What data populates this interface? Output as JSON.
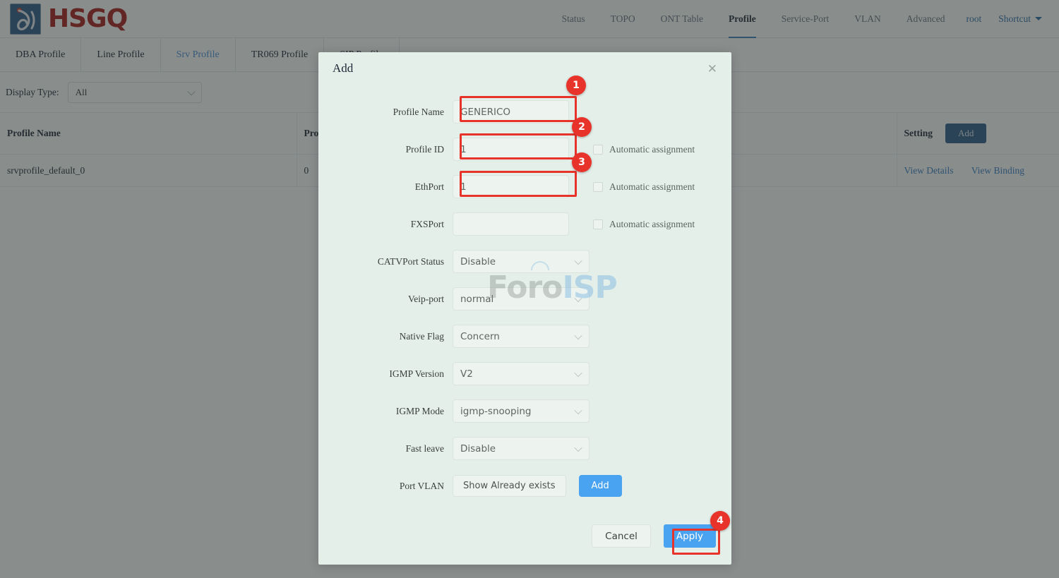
{
  "brand": {
    "name": "HSGQ",
    "logo_icon": "hsgq-droplet-logo"
  },
  "nav": {
    "items": [
      {
        "label": "Status",
        "active": false
      },
      {
        "label": "TOPO",
        "active": false
      },
      {
        "label": "ONT Table",
        "active": false
      },
      {
        "label": "Profile",
        "active": true
      },
      {
        "label": "Service-Port",
        "active": false
      },
      {
        "label": "VLAN",
        "active": false
      },
      {
        "label": "Advanced",
        "active": false
      }
    ],
    "user": "root",
    "shortcut": "Shortcut"
  },
  "tabs": [
    {
      "label": "DBA Profile",
      "active": false
    },
    {
      "label": "Line Profile",
      "active": false
    },
    {
      "label": "Srv Profile",
      "active": true
    },
    {
      "label": "TR069 Profile",
      "active": false
    },
    {
      "label": "SIP Profile",
      "active": false
    }
  ],
  "filter": {
    "label": "Display Type:",
    "value": "All"
  },
  "table": {
    "columns": [
      "Profile Name",
      "Profile ID",
      "Setting"
    ],
    "setting_add_label": "Add",
    "rows": [
      {
        "profile_name": "srvprofile_default_0",
        "profile_id": "0",
        "actions": [
          "View Details",
          "View Binding"
        ]
      }
    ]
  },
  "modal": {
    "title": "Add",
    "close_icon": "close-icon",
    "fields": {
      "profile_name": {
        "label": "Profile Name",
        "value": "GENERICO"
      },
      "profile_id": {
        "label": "Profile ID",
        "value": "1",
        "checkbox": "Automatic assignment",
        "checked": false
      },
      "eth_port": {
        "label": "EthPort",
        "value": "1",
        "checkbox": "Automatic assignment",
        "checked": false
      },
      "fxs_port": {
        "label": "FXSPort",
        "value": "",
        "checkbox": "Automatic assignment",
        "checked": false
      },
      "catv_port_status": {
        "label": "CATVPort Status",
        "value": "Disable"
      },
      "veip_port": {
        "label": "Veip-port",
        "value": "normal"
      },
      "native_flag": {
        "label": "Native Flag",
        "value": "Concern"
      },
      "igmp_version": {
        "label": "IGMP Version",
        "value": "V2"
      },
      "igmp_mode": {
        "label": "IGMP Mode",
        "value": "igmp-snooping"
      },
      "fast_leave": {
        "label": "Fast leave",
        "value": "Disable"
      },
      "port_vlan": {
        "label": "Port VLAN",
        "show_label": "Show Already exists",
        "add_label": "Add"
      }
    },
    "footer": {
      "cancel": "Cancel",
      "apply": "Apply"
    }
  },
  "watermark": {
    "part1": "Foro",
    "part2": "ISP"
  },
  "annotations": {
    "color": "#e8332a",
    "steps": [
      {
        "n": "1",
        "target": "profile-name-input"
      },
      {
        "n": "2",
        "target": "profile-id-input"
      },
      {
        "n": "3",
        "target": "eth-port-input"
      },
      {
        "n": "4",
        "target": "apply-button"
      }
    ]
  }
}
